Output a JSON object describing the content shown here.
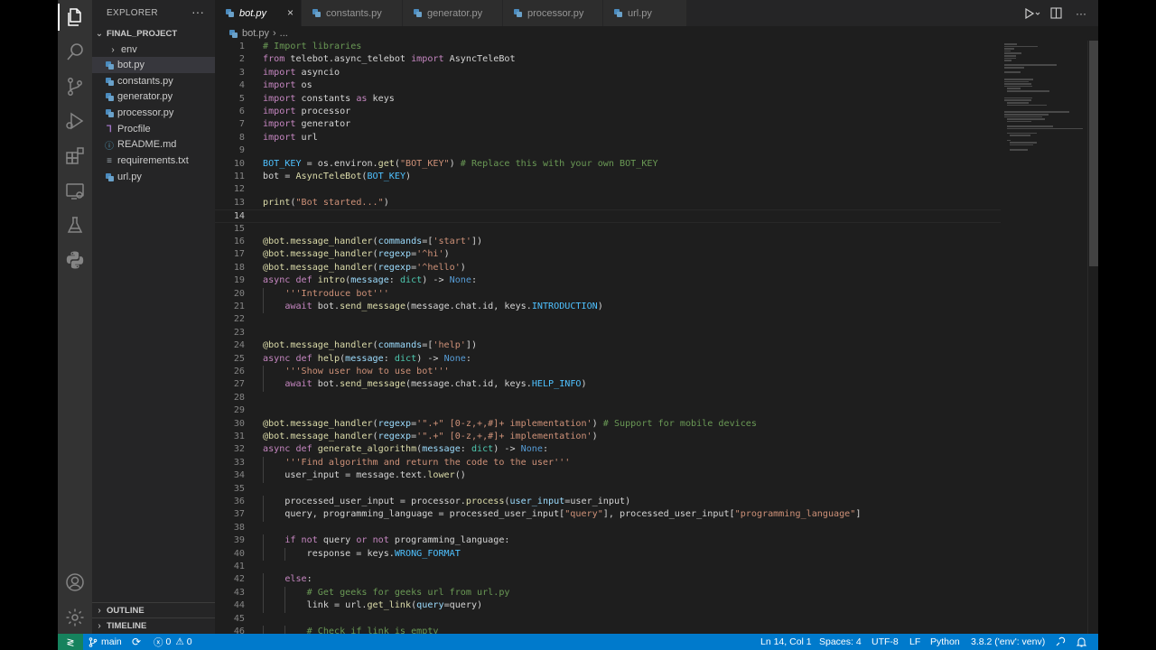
{
  "sidebar": {
    "title": "EXPLORER",
    "more": "···",
    "project": "FINAL_PROJECT",
    "items": [
      {
        "label": "env",
        "kind": "folder"
      },
      {
        "label": "bot.py",
        "kind": "python",
        "selected": true
      },
      {
        "label": "constants.py",
        "kind": "python"
      },
      {
        "label": "generator.py",
        "kind": "python"
      },
      {
        "label": "processor.py",
        "kind": "python"
      },
      {
        "label": "Procfile",
        "kind": "procfile"
      },
      {
        "label": "README.md",
        "kind": "info"
      },
      {
        "label": "requirements.txt",
        "kind": "text"
      },
      {
        "label": "url.py",
        "kind": "python"
      }
    ],
    "outline": "OUTLINE",
    "timeline": "TIMELINE"
  },
  "tabs": [
    {
      "label": "bot.py",
      "active": true
    },
    {
      "label": "constants.py"
    },
    {
      "label": "generator.py"
    },
    {
      "label": "processor.py"
    },
    {
      "label": "url.py"
    }
  ],
  "tab_close": "×",
  "breadcrumb": {
    "file": "bot.py",
    "rest": "..."
  },
  "editor": {
    "current_line": 14,
    "lines": [
      {
        "n": 1,
        "text": "# Import libraries"
      },
      {
        "n": 2,
        "text": "from telebot.async_telebot import AsyncTeleBot"
      },
      {
        "n": 3,
        "text": "import asyncio"
      },
      {
        "n": 4,
        "text": "import os"
      },
      {
        "n": 5,
        "text": "import constants as keys"
      },
      {
        "n": 6,
        "text": "import processor"
      },
      {
        "n": 7,
        "text": "import generator"
      },
      {
        "n": 8,
        "text": "import url"
      },
      {
        "n": 9,
        "text": ""
      },
      {
        "n": 10,
        "text": "BOT_KEY = os.environ.get(\"BOT_KEY\") # Replace this with your own BOT_KEY"
      },
      {
        "n": 11,
        "text": "bot = AsyncTeleBot(BOT_KEY)"
      },
      {
        "n": 12,
        "text": ""
      },
      {
        "n": 13,
        "text": "print(\"Bot started...\")"
      },
      {
        "n": 14,
        "text": ""
      },
      {
        "n": 15,
        "text": ""
      },
      {
        "n": 16,
        "text": "@bot.message_handler(commands=['start'])"
      },
      {
        "n": 17,
        "text": "@bot.message_handler(regexp='^hi')"
      },
      {
        "n": 18,
        "text": "@bot.message_handler(regexp='^hello')"
      },
      {
        "n": 19,
        "text": "async def intro(message: dict) -> None:"
      },
      {
        "n": 20,
        "text": "    '''Introduce bot'''"
      },
      {
        "n": 21,
        "text": "    await bot.send_message(message.chat.id, keys.INTRODUCTION)"
      },
      {
        "n": 22,
        "text": ""
      },
      {
        "n": 23,
        "text": ""
      },
      {
        "n": 24,
        "text": "@bot.message_handler(commands=['help'])"
      },
      {
        "n": 25,
        "text": "async def help(message: dict) -> None:"
      },
      {
        "n": 26,
        "text": "    '''Show user how to use bot'''"
      },
      {
        "n": 27,
        "text": "    await bot.send_message(message.chat.id, keys.HELP_INFO)"
      },
      {
        "n": 28,
        "text": ""
      },
      {
        "n": 29,
        "text": ""
      },
      {
        "n": 30,
        "text": "@bot.message_handler(regexp='\".+\" [0-z,+,#]+ implementation') # Support for mobile devices"
      },
      {
        "n": 31,
        "text": "@bot.message_handler(regexp='\".+\" [0-z,+,#]+ implementation')"
      },
      {
        "n": 32,
        "text": "async def generate_algorithm(message: dict) -> None:"
      },
      {
        "n": 33,
        "text": "    '''Find algorithm and return the code to the user'''"
      },
      {
        "n": 34,
        "text": "    user_input = message.text.lower()"
      },
      {
        "n": 35,
        "text": ""
      },
      {
        "n": 36,
        "text": "    processed_user_input = processor.process(user_input=user_input)"
      },
      {
        "n": 37,
        "text": "    query, programming_language = processed_user_input[\"query\"], processed_user_input[\"programming_language\"]"
      },
      {
        "n": 38,
        "text": ""
      },
      {
        "n": 39,
        "text": "    if not query or not programming_language:"
      },
      {
        "n": 40,
        "text": "        response = keys.WRONG_FORMAT"
      },
      {
        "n": 41,
        "text": ""
      },
      {
        "n": 42,
        "text": "    else:"
      },
      {
        "n": 43,
        "text": "        # Get geeks for geeks url from url.py"
      },
      {
        "n": 44,
        "text": "        link = url.get_link(query=query)"
      },
      {
        "n": 45,
        "text": ""
      },
      {
        "n": 46,
        "text": "        # Check if link is empty"
      }
    ]
  },
  "statusbar": {
    "remote": "≷",
    "branch": "main",
    "sync": "⟳",
    "errors": "0",
    "warnings": "0",
    "position": "Ln 14, Col 1",
    "spaces": "Spaces: 4",
    "encoding": "UTF-8",
    "eol": "LF",
    "language": "Python",
    "interpreter": "3.8.2 ('env': venv)"
  },
  "icons": {
    "explorer": "files-icon",
    "search": "search-icon",
    "scm": "source-control-icon",
    "debug": "run-debug-icon",
    "extensions": "extensions-icon",
    "remote": "remote-explorer-icon",
    "testing": "flask-icon",
    "python": "python-icon",
    "account": "account-icon",
    "settings": "gear-icon"
  },
  "colors": {
    "statusbar": "#007acc",
    "remote": "#16825d",
    "activitybar": "#333333",
    "sidebar": "#252526",
    "editor": "#1e1e1e"
  }
}
